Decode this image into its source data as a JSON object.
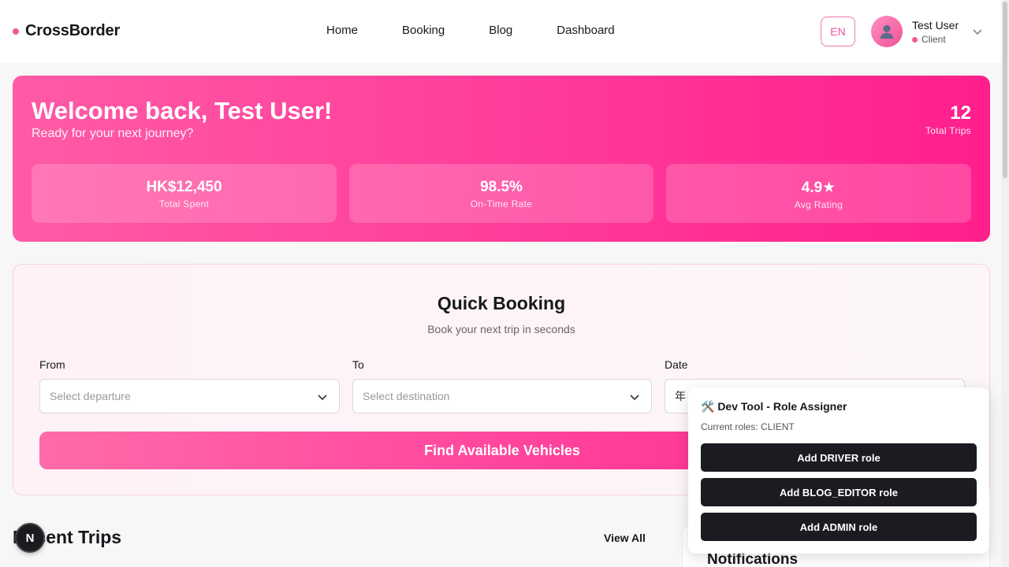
{
  "header": {
    "brand": "CrossBorder",
    "nav": [
      "Home",
      "Booking",
      "Blog",
      "Dashboard"
    ],
    "language": "EN",
    "user": {
      "name": "Test User",
      "role": "Client",
      "avatar_icon": "user-icon"
    }
  },
  "hero": {
    "welcome": "Welcome back, Test User!",
    "subtitle": "Ready for your next journey?",
    "total_trips_value": "12",
    "total_trips_label": "Total Trips",
    "stats": [
      {
        "value": "HK$12,450",
        "label": "Total Spent"
      },
      {
        "value": "98.5%",
        "label": "On-Time Rate"
      },
      {
        "value": "4.9★",
        "label": "Avg Rating"
      }
    ]
  },
  "quick_booking": {
    "title": "Quick Booking",
    "subtitle": "Book your next trip in seconds",
    "from_label": "From",
    "from_placeholder": "Select departure",
    "to_label": "To",
    "to_placeholder": "Select destination",
    "date_label": "Date",
    "date_value": "年",
    "submit": "Find Available Vehicles"
  },
  "recent_trips": {
    "title": "Recent Trips",
    "view_all": "View All"
  },
  "notifications": {
    "title": "Notifications"
  },
  "nextjs_badge": "N",
  "dev_tool": {
    "title": "🛠️ Dev Tool - Role Assigner",
    "current_roles": "Current roles: CLIENT",
    "buttons": [
      "Add DRIVER role",
      "Add BLOG_EDITOR role",
      "Add ADMIN role"
    ]
  },
  "colors": {
    "accent": "#ff3d9a",
    "dark_button": "#1b1c22"
  }
}
